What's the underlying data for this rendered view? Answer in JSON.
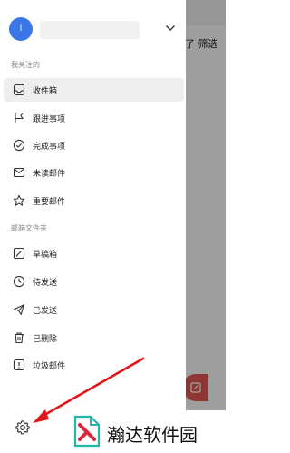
{
  "background": {
    "filter_label": "了 筛选"
  },
  "account": {
    "avatar_letter": "l"
  },
  "sections": {
    "followed": "我关注的",
    "folders": "邮箱文件夹"
  },
  "followed_items": [
    {
      "label": "收件箱",
      "icon": "inbox-icon"
    },
    {
      "label": "跟进事项",
      "icon": "flag-icon"
    },
    {
      "label": "完成事项",
      "icon": "check-circle-icon"
    },
    {
      "label": "未读邮件",
      "icon": "envelope-icon"
    },
    {
      "label": "重要邮件",
      "icon": "star-icon"
    }
  ],
  "folder_items": [
    {
      "label": "草稿箱",
      "icon": "draft-icon"
    },
    {
      "label": "待发送",
      "icon": "clock-icon"
    },
    {
      "label": "已发送",
      "icon": "send-icon"
    },
    {
      "label": "已删除",
      "icon": "trash-icon"
    },
    {
      "label": "垃圾邮件",
      "icon": "spam-icon"
    }
  ],
  "watermark": {
    "text": "瀚达软件园"
  },
  "colors": {
    "avatar": "#3b76e8",
    "accent_red": "#d9534f",
    "arrow": "#e0161b"
  }
}
